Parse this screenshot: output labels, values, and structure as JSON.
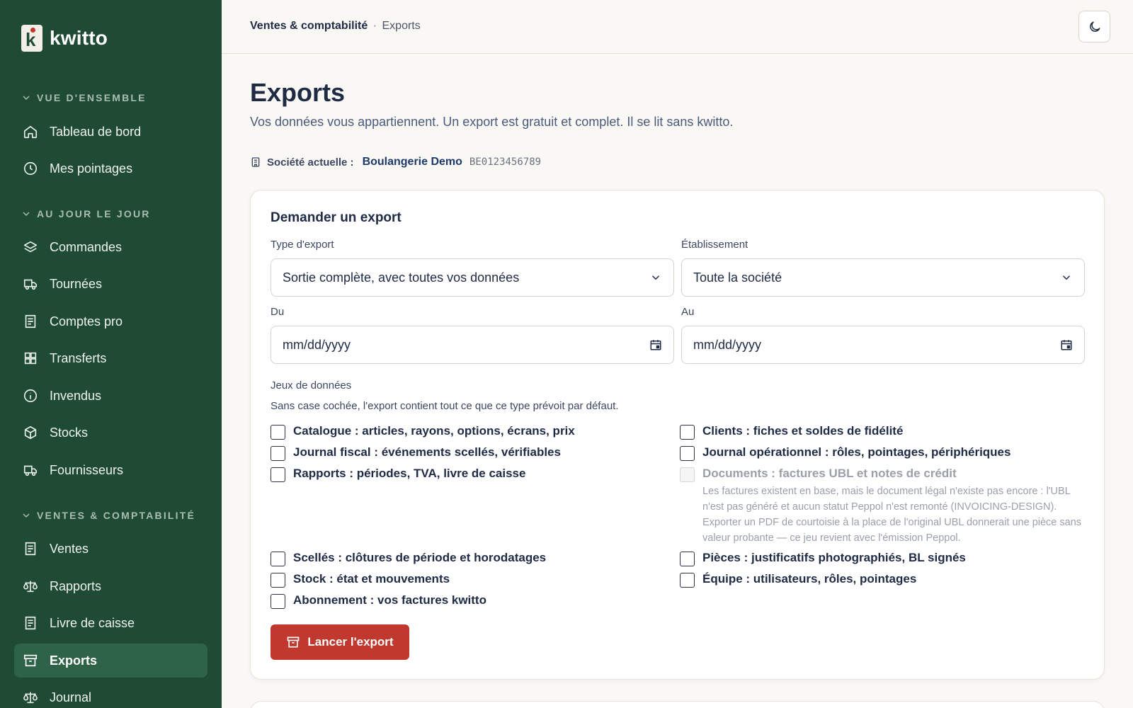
{
  "app": {
    "name": "kwitto"
  },
  "sidebar": {
    "sections": [
      {
        "label": "VUE D'ENSEMBLE"
      },
      {
        "label": "AU JOUR LE JOUR"
      },
      {
        "label": "VENTES & COMPTABILITÉ"
      }
    ],
    "items": [
      {
        "label": "Tableau de bord",
        "icon": "home-icon"
      },
      {
        "label": "Mes pointages",
        "icon": "clock-icon"
      },
      {
        "label": "Commandes",
        "icon": "layers-icon"
      },
      {
        "label": "Tournées",
        "icon": "truck-icon"
      },
      {
        "label": "Comptes pro",
        "icon": "document-icon"
      },
      {
        "label": "Transferts",
        "icon": "grid-icon"
      },
      {
        "label": "Invendus",
        "icon": "info-icon"
      },
      {
        "label": "Stocks",
        "icon": "box-icon"
      },
      {
        "label": "Fournisseurs",
        "icon": "truck-icon"
      },
      {
        "label": "Ventes",
        "icon": "document-icon"
      },
      {
        "label": "Rapports",
        "icon": "scale-icon"
      },
      {
        "label": "Livre de caisse",
        "icon": "document-icon"
      },
      {
        "label": "Exports",
        "icon": "archive-icon",
        "active": true
      },
      {
        "label": "Journal",
        "icon": "scale-icon"
      }
    ]
  },
  "header": {
    "breadcrumb_section": "Ventes & comptabilité",
    "breadcrumb_sep": "·",
    "breadcrumb_page": "Exports",
    "theme_icon": "moon-icon"
  },
  "main": {
    "title": "Exports",
    "subtitle": "Vos données vous appartiennent. Un export est gratuit et complet. Il se lit sans kwitto.",
    "company_label": "Société actuelle :",
    "company_name": "Boulangerie Demo",
    "company_vat": "BE0123456789"
  },
  "form": {
    "title": "Demander un export",
    "type_label": "Type d'export",
    "type_value": "Sortie complète, avec toutes vos données",
    "establishment_label": "Établissement",
    "establishment_value": "Toute la société",
    "from_label": "Du",
    "from_value": "mm/dd/yyyy",
    "to_label": "Au",
    "to_value": "mm/dd/yyyy",
    "datasets_label": "Jeux de données",
    "datasets_hint": "Sans case cochée, l'export contient tout ce que ce type prévoit par défaut.",
    "datasets": {
      "catalogue": "Catalogue : articles, rayons, options, écrans, prix",
      "journal_fiscal": "Journal fiscal : événements scellés, vérifiables",
      "rapports": "Rapports : périodes, TVA, livre de caisse",
      "clients": "Clients : fiches et soldes de fidélité",
      "journal_ops": "Journal opérationnel : rôles, pointages, périphériques",
      "documents": "Documents : factures UBL et notes de crédit",
      "documents_note": "Les factures existent en base, mais le document légal n'existe pas encore : l'UBL n'est pas généré et aucun statut Peppol n'est remonté (INVOICING-DESIGN). Exporter un PDF de courtoisie à la place de l'original UBL donnerait une pièce sans valeur probante — ce jeu revient avec l'émission Peppol.",
      "scelles": "Scellés : clôtures de période et horodatages",
      "stock": "Stock : état et mouvements",
      "abonnement": "Abonnement : vos factures kwitto",
      "pieces": "Pièces : justificatifs photographiés, BL signés",
      "equipe": "Équipe : utilisateurs, rôles, pointages"
    },
    "submit_label": "Lancer l'export"
  }
}
